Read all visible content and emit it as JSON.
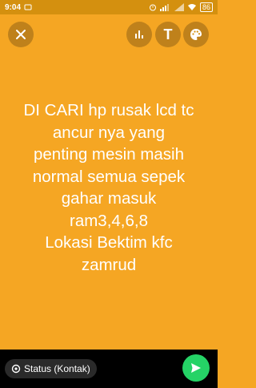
{
  "status_bar": {
    "time": "9:04",
    "battery": "86"
  },
  "toolbar": {
    "close_icon": "close-icon",
    "stats_icon": "bar-chart-icon",
    "text_icon_label": "T",
    "palette_icon": "palette-icon"
  },
  "main": {
    "lines": [
      "DI CARI hp rusak lcd tc",
      "ancur nya yang",
      "penting mesin masih",
      "normal semua sepek",
      "gahar masuk",
      "ram3,4,6,8",
      "Lokasi Bektim kfc",
      "zamrud"
    ]
  },
  "bottom": {
    "privacy_label": "Status (Kontak)",
    "send_icon": "send-icon"
  },
  "colors": {
    "background": "#f5a623",
    "status_bar": "#d4900f",
    "send": "#25d366"
  }
}
